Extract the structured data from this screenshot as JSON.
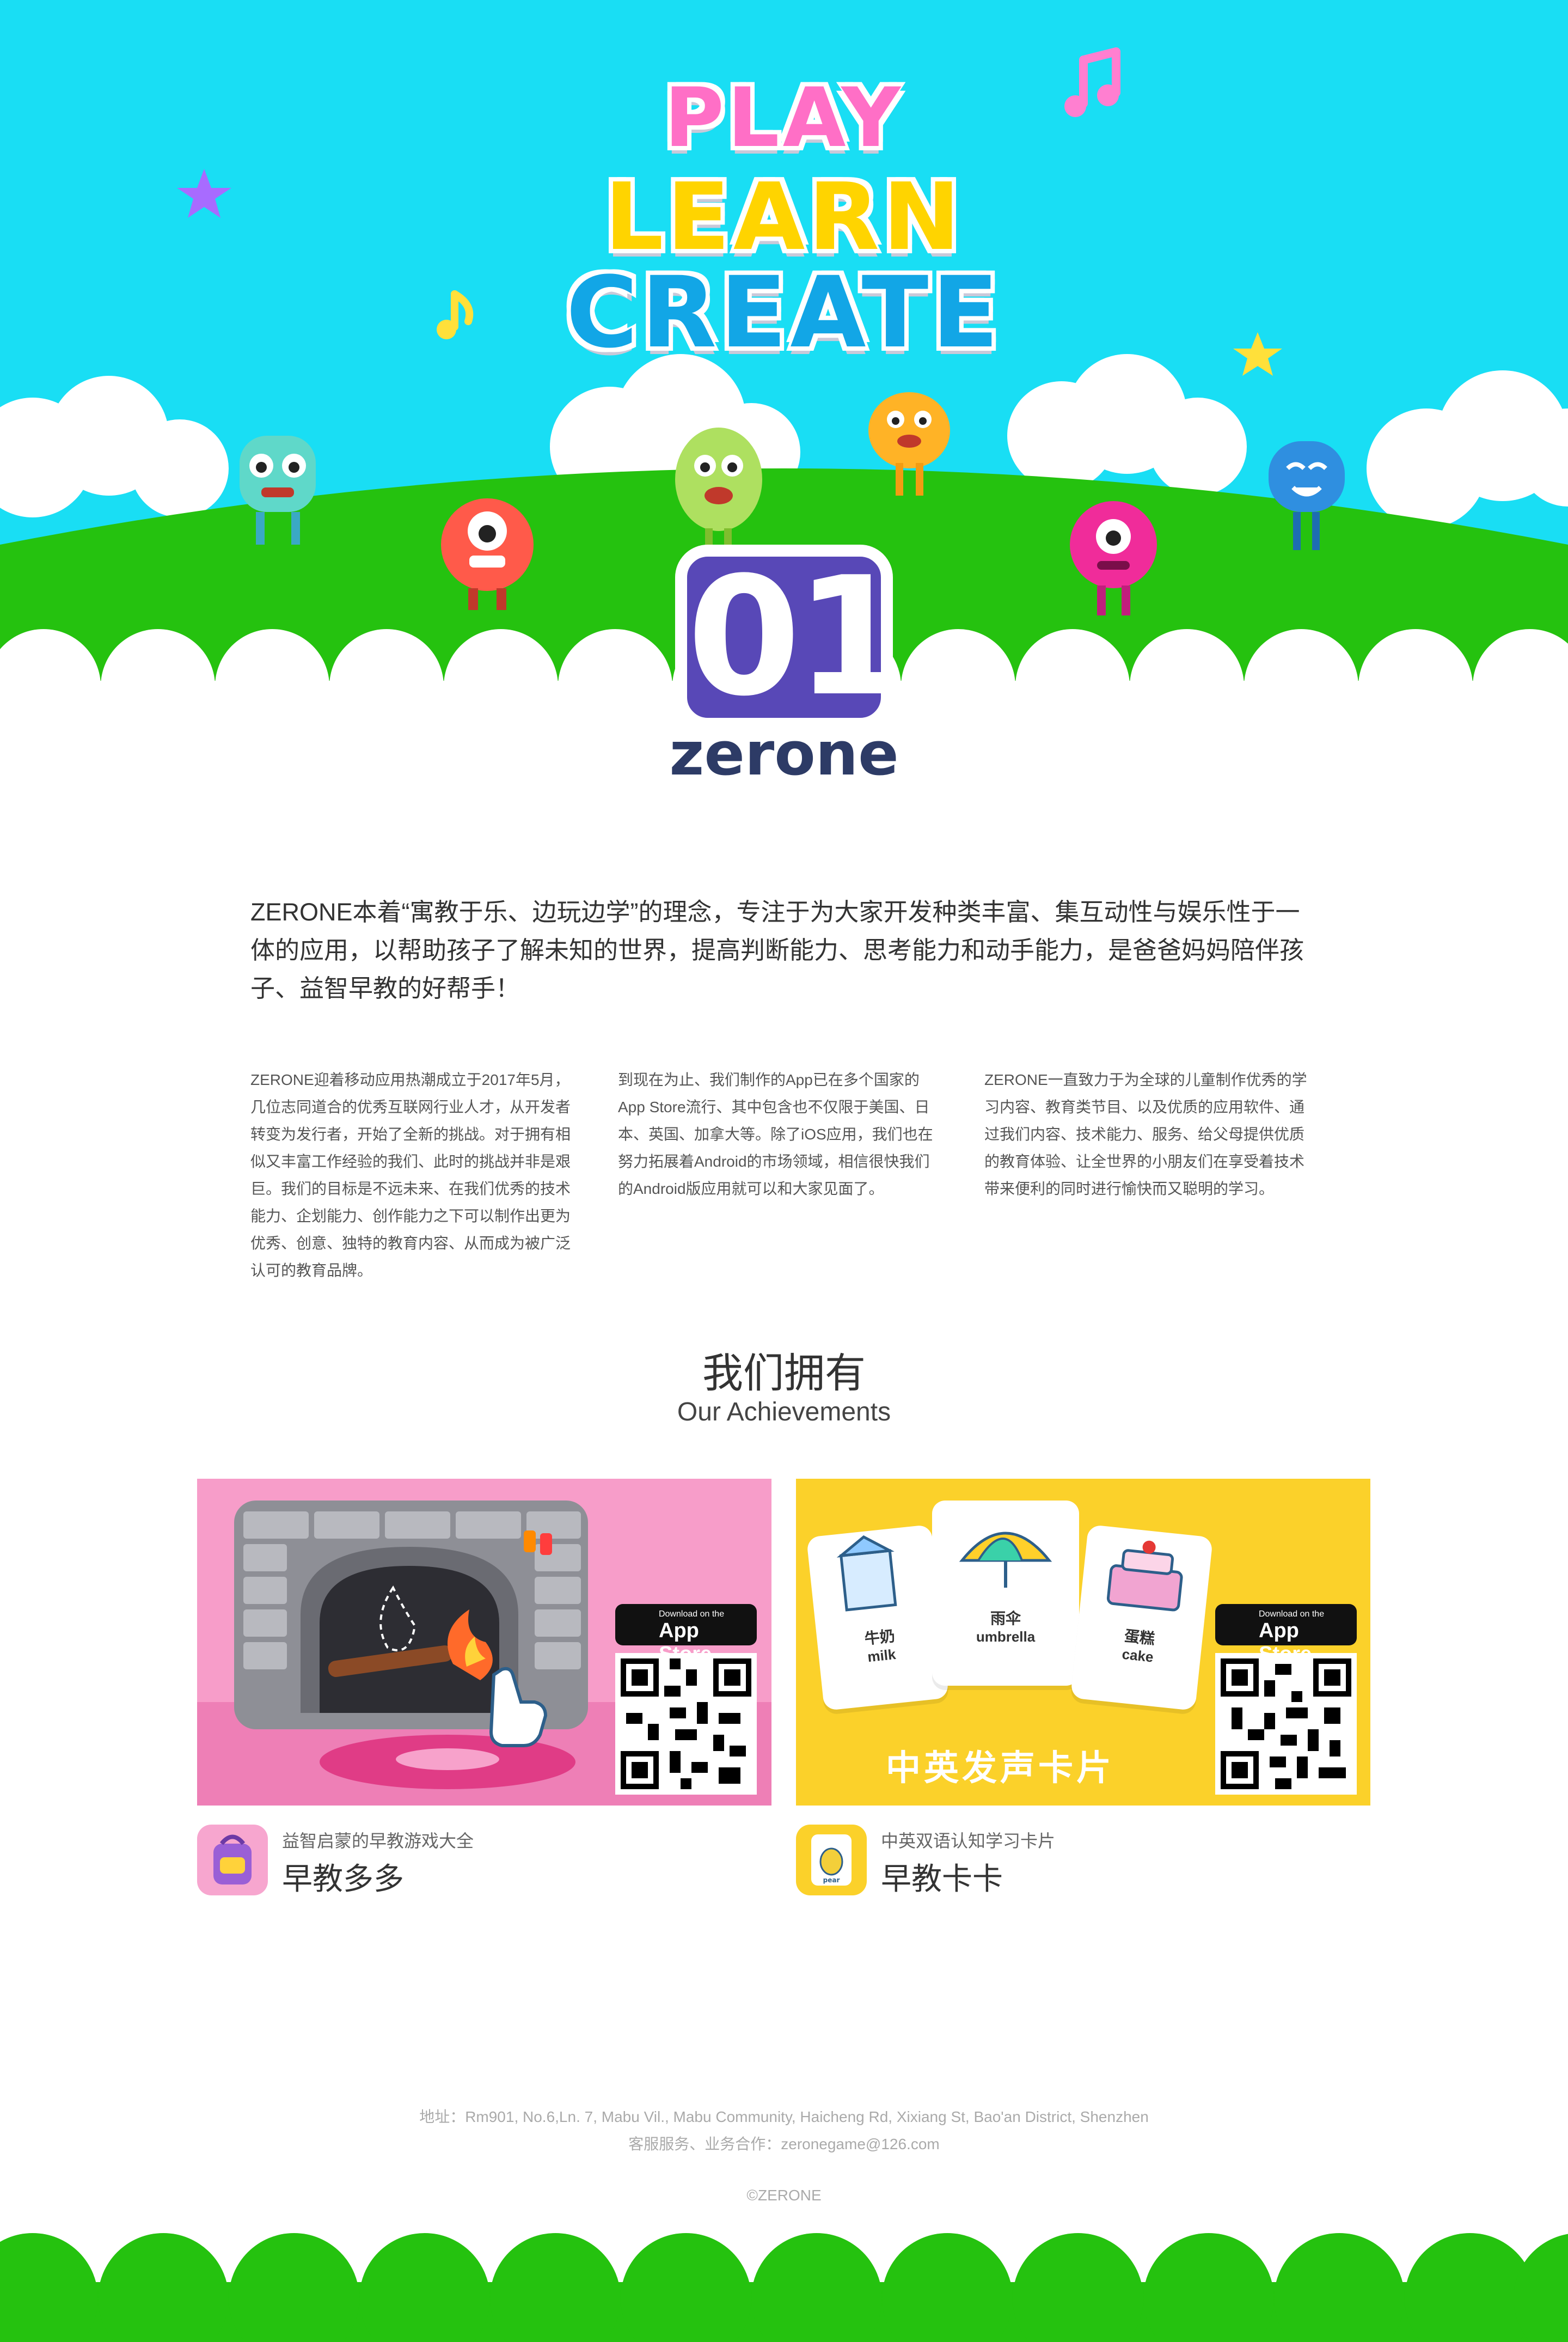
{
  "hero": {
    "logo": {
      "play": "PLAY",
      "learn": "LEARN",
      "create": "CREATE"
    }
  },
  "brand": {
    "number": "01",
    "name": "zerone"
  },
  "intro": "ZERONE本着“寓教于乐、边玩边学”的理念，专注于为大家开发种类丰富、集互动性与娱乐性于一体的应用，以帮助孩子了解未知的世界，提高判断能力、思考能力和动手能力，是爸爸妈妈陪伴孩子、益智早教的好帮手！",
  "columns": [
    "ZERONE迎着移动应用热潮成立于2017年5月，几位志同道合的优秀互联网行业人才，从开发者转变为发行者，开始了全新的挑战。对于拥有相似又丰富工作经验的我们、此时的挑战并非是艰巨。我们的目标是不远未来、在我们优秀的技术能力、企划能力、创作能力之下可以制作出更为优秀、创意、独特的教育内容、从而成为被广泛认可的教育品牌。",
    "到现在为止、我们制作的App已在多个国家的App Store流行、其中包含也不仅限于美国、日本、英国、加拿大等。除了iOS应用，我们也在努力拓展着Android的市场领域，相信很快我们的Android版应用就可以和大家见面了。",
    "ZERONE一直致力于为全球的儿童制作优秀的学习内容、教育类节目、以及优质的应用软件、通过我们内容、技术能力、服务、给父母提供优质的教育体验、让全世界的小朋友们在享受着技术带来便利的同时进行愉快而又聪明的学习。"
  ],
  "achievements": {
    "title": "我们拥有",
    "subtitle": "Our Achievements"
  },
  "apps": [
    {
      "subtitle": "益智启蒙的早教游戏大全",
      "title": "早教多多",
      "badge_small": "Download on the",
      "badge_big": "App Store",
      "icon": "backpack-icon"
    },
    {
      "subtitle": "中英双语认知学习卡片",
      "title": "早教卡卡",
      "badge_small": "Download on the",
      "badge_big": "App Store",
      "icon": "pear-card-icon",
      "banner_caption": "中英发声卡片",
      "cards": [
        {
          "cn": "牛奶",
          "en": "milk",
          "icon": "milk-icon"
        },
        {
          "cn": "雨伞",
          "en": "umbrella",
          "icon": "umbrella-icon"
        },
        {
          "cn": "蛋糕",
          "en": "cake",
          "icon": "cake-icon"
        }
      ],
      "pear_label": "pear"
    }
  ],
  "footer": {
    "address": "地址：Rm901, No.6,Ln. 7, Mabu Vil., Mabu Community, Haicheng Rd, Xixiang St, Bao'an District, Shenzhen",
    "contact": "客服服务、业务合作：zeronegame@126.com",
    "copyright": "©ZERONE"
  },
  "colors": {
    "sky": "#19def4",
    "grass": "#25c20f",
    "brand_purple": "#5848b7",
    "brand_navy": "#2d3b66",
    "card_pink": "#f79dc9",
    "card_yellow": "#fbd12a"
  }
}
